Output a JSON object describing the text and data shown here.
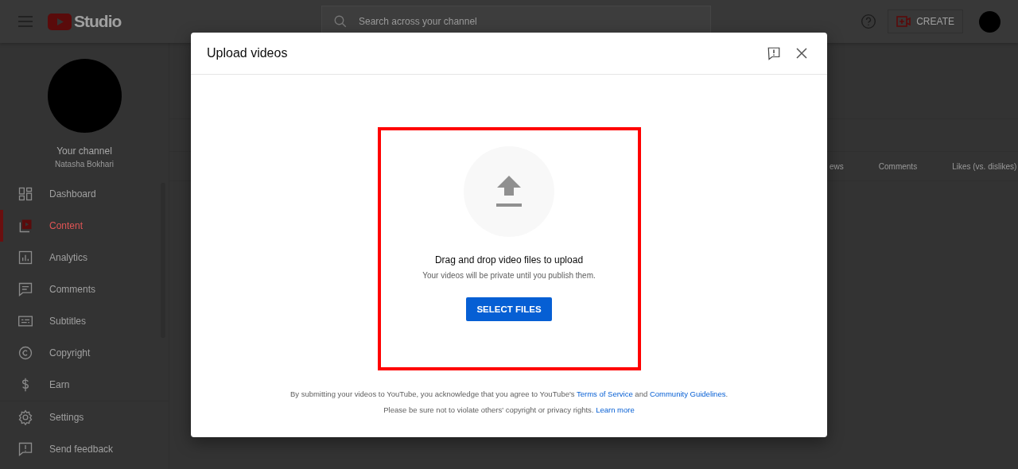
{
  "top_bar": {
    "logo_text": "Studio",
    "search": {
      "placeholder": "Search across your channel"
    },
    "create_label": "CREATE"
  },
  "sidebar": {
    "channel_title": "Your channel",
    "channel_name": "Natasha Bokhari",
    "items": [
      {
        "label": "Dashboard",
        "selected": false
      },
      {
        "label": "Content",
        "selected": true
      },
      {
        "label": "Analytics",
        "selected": false
      },
      {
        "label": "Comments",
        "selected": false
      },
      {
        "label": "Subtitles",
        "selected": false
      },
      {
        "label": "Copyright",
        "selected": false
      },
      {
        "label": "Earn",
        "selected": false
      }
    ],
    "footer_items": [
      {
        "label": "Settings"
      },
      {
        "label": "Send feedback"
      }
    ]
  },
  "table": {
    "columns": [
      "ews",
      "Comments",
      "Likes (vs. dislikes)"
    ]
  },
  "dialog": {
    "title": "Upload videos",
    "drop_title": "Drag and drop video files to upload",
    "drop_subtitle": "Your videos will be private until you publish them.",
    "button": "SELECT FILES",
    "legal_line_1": [
      {
        "text": "By submitting your videos to YouTube, you acknowledge that you agree to YouTube's ",
        "link": false
      },
      {
        "text": "Terms of Service",
        "link": true
      },
      {
        "text": " and ",
        "link": false
      },
      {
        "text": "Community Guidelines",
        "link": true
      },
      {
        "text": ".",
        "link": false
      }
    ],
    "legal_line_2": [
      {
        "text": "Please be sure not to violate others' copyright or privacy rights. ",
        "link": false
      },
      {
        "text": "Learn more",
        "link": true
      }
    ]
  }
}
